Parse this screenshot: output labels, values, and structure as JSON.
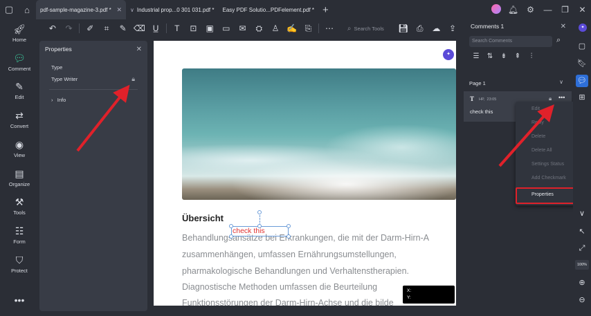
{
  "tabs": [
    {
      "label": "pdf-sample-magazine-3.pdf *",
      "active": true
    },
    {
      "label": "Industrial  prop...0 301 031.pdf *",
      "active": false
    },
    {
      "label": "Easy PDF Solutio...PDFelement.pdf *",
      "active": false
    }
  ],
  "rail": [
    {
      "label": "Home",
      "icon": "rocket-icon"
    },
    {
      "label": "Comment",
      "icon": "comment-icon"
    },
    {
      "label": "Edit",
      "icon": "edit-icon"
    },
    {
      "label": "Convert",
      "icon": "convert-icon"
    },
    {
      "label": "View",
      "icon": "eye-icon"
    },
    {
      "label": "Organize",
      "icon": "organize-icon"
    },
    {
      "label": "Tools",
      "icon": "toolbox-icon"
    },
    {
      "label": "Form",
      "icon": "form-icon"
    },
    {
      "label": "Protect",
      "icon": "shield-icon"
    }
  ],
  "toolbar": {
    "search_placeholder": "Search Tools"
  },
  "properties": {
    "title": "Properties",
    "type_label": "Type",
    "type_value": "Type Writer",
    "info_label": "Info"
  },
  "document": {
    "heading": "Übersicht",
    "annotation_text": "check this",
    "lines": [
      "Behandlungsansätze bei Erkrankungen, die mit der Darm-Hirn-A",
      "zusammenhängen, umfassen Ernährungsumstellungen,",
      "pharmakologische Behandlungen und Verhaltenstherapien.",
      "Diagnostische Methoden umfassen die Beurteilung",
      "Funktionsstörungen der Darm-Hirn-Achse und die bilde"
    ],
    "coords_x": "X:",
    "coords_y": "Y:"
  },
  "comments": {
    "title": "Comments 1",
    "search_placeholder": "Search Comments",
    "page_label": "Page 1",
    "card": {
      "author": "HP,",
      "time": "23:05",
      "text": "check this"
    }
  },
  "context_menu": {
    "items": [
      {
        "label": "Edit",
        "enabled": false
      },
      {
        "label": "Reply",
        "enabled": false
      },
      {
        "label": "Delete",
        "enabled": false
      },
      {
        "label": "Delete All",
        "enabled": false
      },
      {
        "label": "Settings Status",
        "enabled": false
      },
      {
        "label": "Add Checkmark",
        "enabled": false
      },
      {
        "label": "Properties",
        "enabled": true
      }
    ]
  },
  "zoom": "100%",
  "colors": {
    "accent_blue": "#2e6fd8",
    "comment_green": "#3dd6a5",
    "highlight_red": "#e0212a",
    "annotation_red": "#e03030"
  }
}
